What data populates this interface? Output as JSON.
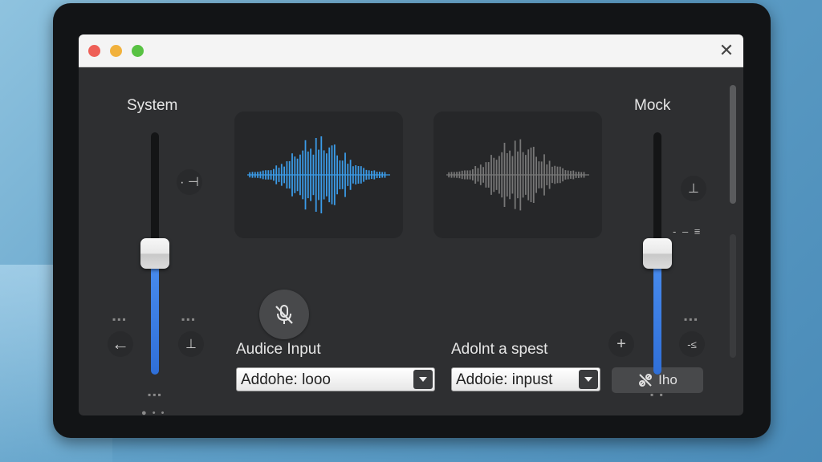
{
  "left_channel": {
    "label": "System",
    "level": 0.5
  },
  "right_channel": {
    "label": "Mock",
    "level": 0.5
  },
  "left_icons": {
    "top": "·  ⊣",
    "middle_dots": "▪▪▪",
    "middle_dots_right": "▪▪▪",
    "back": "←",
    "plus": "⊥",
    "bottom_dots": "▪▪▪",
    "pager": "● • •"
  },
  "right_icons": {
    "top": "⊥",
    "side": "- ‒ ≡",
    "dots1": "▪▪▪",
    "plus": "+",
    "side2": "-≤",
    "bottom_dots": "▪ ▪"
  },
  "input_section": {
    "label": "Audice Input",
    "value": "Addohe: looo"
  },
  "output_section": {
    "label": "Adolnt a spest",
    "value": "Addoie: inpust"
  },
  "action_button": {
    "label": "Iho"
  },
  "colors": {
    "accent": "#3d8ef0",
    "wave_active": "#3b9be8",
    "wave_inactive": "#777777"
  }
}
